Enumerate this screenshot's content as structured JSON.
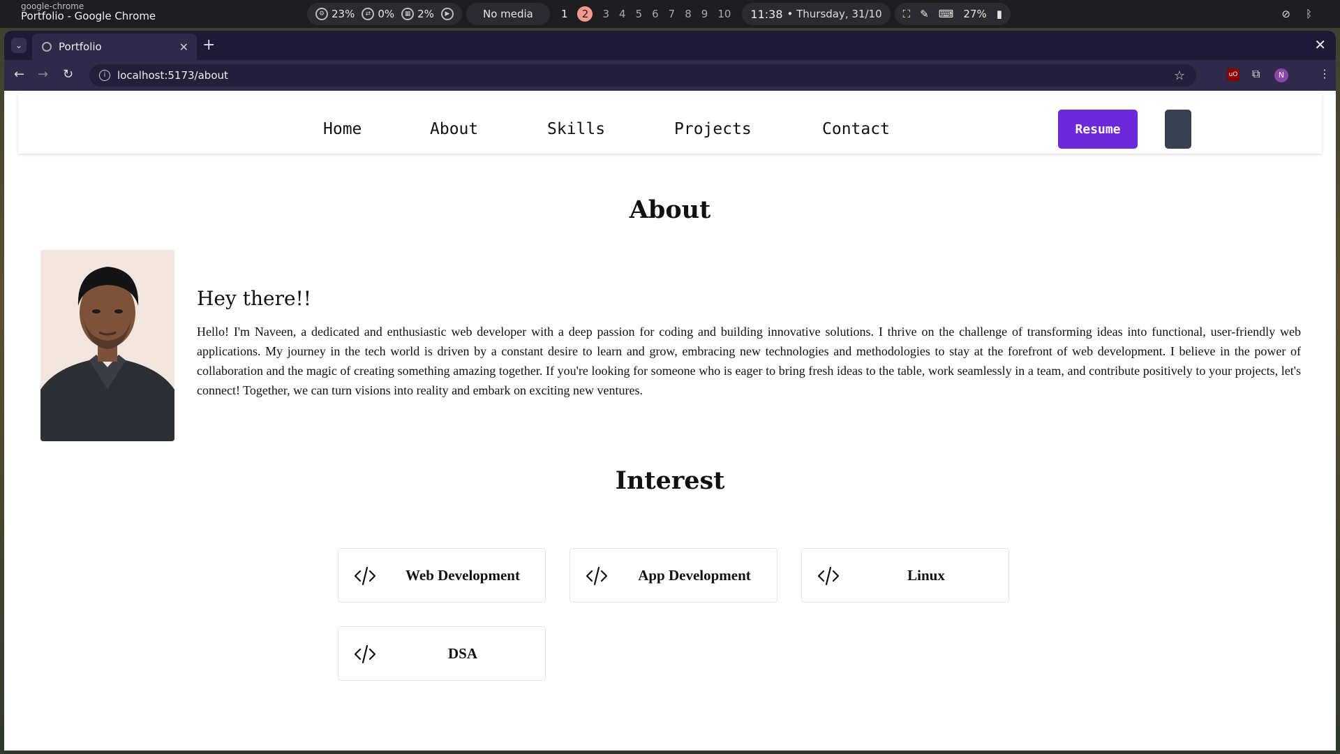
{
  "system_bar": {
    "app_name": "google-chrome",
    "window_title": "Portfolio - Google Chrome",
    "cpu": "23%",
    "swap": "0%",
    "memory": "2%",
    "media": "No media",
    "workspaces": [
      "1",
      "2",
      "3",
      "4",
      "5",
      "6",
      "7",
      "8",
      "9",
      "10"
    ],
    "active_workspace": "2",
    "time": "11:38",
    "date": "• Thursday, 31/10",
    "battery": "27%"
  },
  "browser": {
    "tab_title": "Portfolio",
    "url": "localhost:5173/about",
    "profile_initial": "N",
    "ublock_label": "uO"
  },
  "navbar": {
    "links": [
      "Home",
      "About",
      "Skills",
      "Projects",
      "Contact"
    ],
    "resume_label": "Resume"
  },
  "about": {
    "heading": "About",
    "greeting": "Hey there!!",
    "bio": "Hello! I'm Naveen, a dedicated and enthusiastic web developer with a deep passion for coding and building innovative solutions. I thrive on the challenge of transforming ideas into functional, user-friendly web applications. My journey in the tech world is driven by a constant desire to learn and grow, embracing new technologies and methodologies to stay at the forefront of web development. I believe in the power of collaboration and the magic of creating something amazing together. If you're looking for someone who is eager to bring fresh ideas to the table, work seamlessly in a team, and contribute positively to your projects, let's connect! Together, we can turn visions into reality and embark on exciting new ventures."
  },
  "interest": {
    "heading": "Interest",
    "items": [
      "Web Development",
      "App Development",
      "Linux",
      "DSA"
    ],
    "icon": "code-icon"
  },
  "colors": {
    "accent": "#6d28d9",
    "toggle": "#374151",
    "browser_frame": "#2f2a4a",
    "active_workspace": "#f29b8c"
  }
}
